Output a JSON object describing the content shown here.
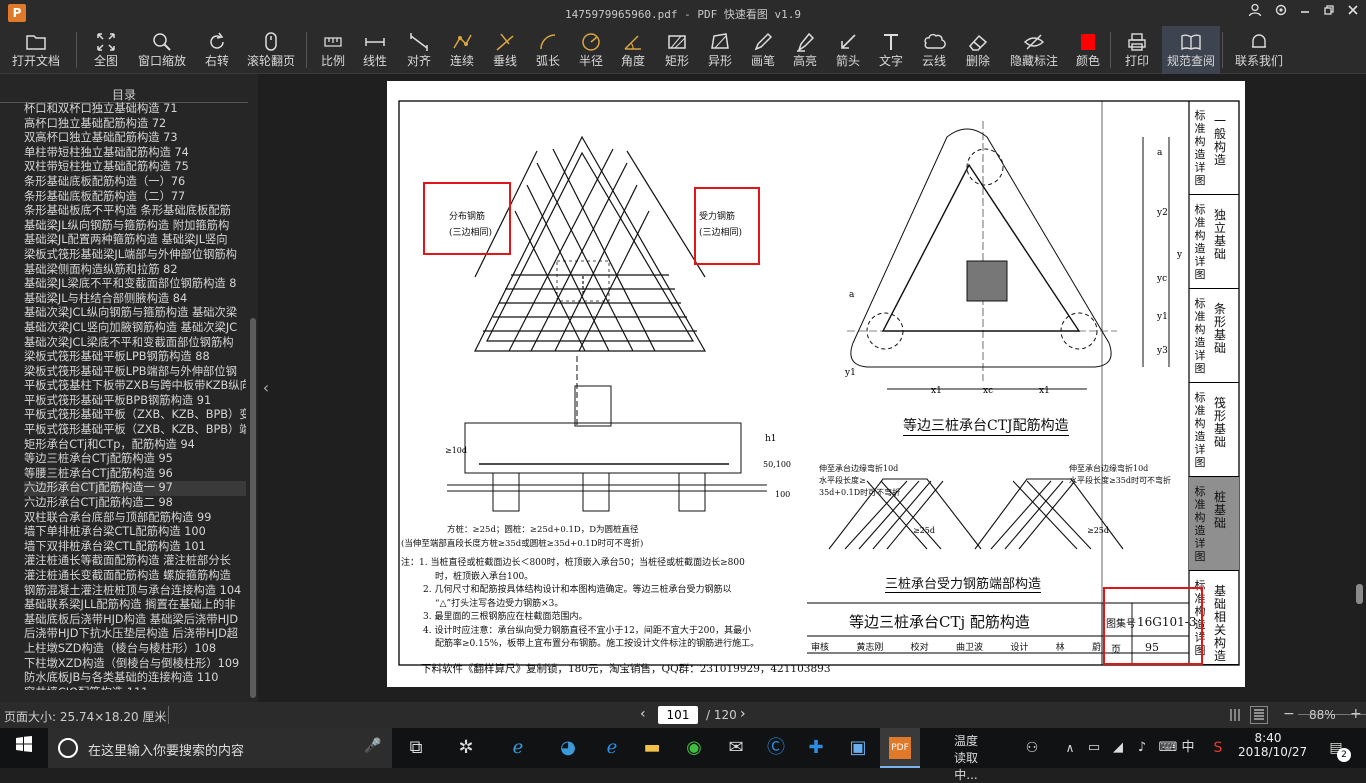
{
  "window": {
    "title": "1475979965960.pdf - PDF 快速看图 v1.9",
    "logo": "P",
    "controls": [
      "user-icon",
      "settings-icon",
      "minimize-icon",
      "maximize-icon",
      "close-icon"
    ]
  },
  "toolbar": [
    {
      "label": "打开文档",
      "icon": "folder-icon"
    },
    {
      "label": "全图",
      "icon": "fit-page-icon"
    },
    {
      "label": "窗口缩放",
      "icon": "zoom-icon"
    },
    {
      "label": "右转",
      "icon": "rotate-right-icon"
    },
    {
      "label": "滚轮翻页",
      "icon": "mouse-wheel-icon"
    },
    {
      "label": "比例",
      "icon": "scale-icon"
    },
    {
      "label": "线性",
      "icon": "linear-measure-icon"
    },
    {
      "label": "对齐",
      "icon": "align-measure-icon"
    },
    {
      "label": "连续",
      "icon": "continuous-measure-icon"
    },
    {
      "label": "垂线",
      "icon": "perpendicular-icon"
    },
    {
      "label": "弧长",
      "icon": "arc-length-icon"
    },
    {
      "label": "半径",
      "icon": "radius-icon"
    },
    {
      "label": "角度",
      "icon": "angle-icon"
    },
    {
      "label": "矩形",
      "icon": "rectangle-area-icon"
    },
    {
      "label": "异形",
      "icon": "polygon-area-icon"
    },
    {
      "label": "画笔",
      "icon": "pen-icon"
    },
    {
      "label": "高亮",
      "icon": "highlighter-icon"
    },
    {
      "label": "箭头",
      "icon": "arrow-icon"
    },
    {
      "label": "文字",
      "icon": "text-icon"
    },
    {
      "label": "云线",
      "icon": "cloud-line-icon"
    },
    {
      "label": "删除",
      "icon": "eraser-icon"
    },
    {
      "label": "隐藏标注",
      "icon": "hide-annotation-icon"
    },
    {
      "label": "颜色",
      "icon": "color-swatch-icon"
    },
    {
      "label": "打印",
      "icon": "printer-icon"
    },
    {
      "label": "规范查阅",
      "icon": "book-icon"
    },
    {
      "label": "联系我们",
      "icon": "contact-icon"
    }
  ],
  "colors": {
    "annotation_color": "#ff0000",
    "highlight_box": "#e0161b"
  },
  "sidebar": {
    "title": "目录",
    "selected_index": 26,
    "items": [
      "杯口和双杯口独立基础构造 71",
      "高杯口独立基础配筋构造 72",
      "双高杯口独立基础配筋构造 73",
      "单柱带短柱独立基础配筋构造 74",
      "双柱带短柱独立基础配筋构造 75",
      "条形基础底板配筋构造（一）76",
      "条形基础底板配筋构造（二）77",
      "条形基础板底不平构造 条形基础底板配筋",
      "基础梁JL纵向钢筋与箍筋构造 附加箍筋构",
      "基础梁JL配置两种箍筋构造 基础梁JL竖向",
      "梁板式筏形基础梁JL端部与外伸部位钢筋构",
      "基础梁侧面构造纵筋和拉筋 82",
      "基础梁JL梁底不平和变截面部位钢筋构造 8",
      "基础梁JL与柱结合部侧腋构造 84",
      "基础次梁JCL纵向钢筋与箍筋构造 基础次梁",
      "基础次梁JCL竖向加腋钢筋构造 基础次梁JC",
      "基础次梁JCL梁底不平和变截面部位钢筋构",
      "梁板式筏形基础平板LPB钢筋构造 88",
      "梁板式筏形基础平板LPB端部与外伸部位钢",
      "平板式筏基柱下板带ZXB与跨中板带KZB纵向",
      "平板式筏形基础平板BPB钢筋构造 91",
      "平板式筏形基础平板（ZXB、KZB、BPB）变截",
      "平板式筏形基础平板（ZXB、KZB、BPB）端部",
      "矩形承台CTj和CTp，配筋构造 94",
      "等边三桩承台CTj配筋构造 95",
      "等腰三桩承台CTj配筋构造 96",
      "六边形承台CTj配筋构造一 97",
      "六边形承台CTj配筋构造二 98",
      "双柱联合承台底部与顶部配筋构造 99",
      "墙下单排桩承台梁CTL配筋构造 100",
      "墙下双排桩承台梁CTL配筋构造 101",
      "灌注桩通长等截面配筋构造 灌注桩部分长",
      "灌注桩通长变截面配筋构造 螺旋箍筋构造",
      "钢筋混凝土灌注桩桩顶与承台连接构造 104",
      "基础联系梁JLL配筋构造 搁置在基础上的非",
      "基础底板后浇带HJD构造 基础梁后浇带HJD",
      "后浇带HJD下抗水压垫层构造 后浇带HJD超",
      "上柱墩SZD构造（棱台与棱柱形）108",
      "下柱墩XZD构造（倒棱台与倒棱柱形）109",
      "防水底板JB与各类基础的连接构造 110",
      "窗井墙CJQ配筋构造 111",
      "封底"
    ]
  },
  "document": {
    "label_distribution": "分布钢筋",
    "label_distribution_sub": "(三边相同)",
    "label_stressed": "受力钢筋",
    "label_stressed_sub": "(三边相同)",
    "title_plan": "等边三桩承台CTJ配筋构造",
    "title_end": "三桩承台受力钢筋端部构造",
    "dim_note": "方桩：≥25d；圆桩：≥25d+0.1D，D为圆桩直径",
    "dim_note2": "(当伸至端部直段长度方桩≥35d或圆桩≥35d+0.1D时可不弯折)",
    "end_note_left": "伸至承台边缘弯折10d",
    "end_note_left2": "水平段长度≥",
    "end_note_left3": "35d+0.1D时可不弯折",
    "end_note_right": "伸至承台边缘弯折10d",
    "end_note_right2": "水平段长度≥35d时可不弯折",
    "notes": [
      "注：1. 当桩直径或桩截面边长＜800时，桩顶嵌入承台50；当桩径或桩截面边长≥800",
      "时，桩顶嵌入承台100。",
      "2. 几何尺寸和配筋按具体结构设计和本图构造确定。等边三桩承台受力钢筋以",
      "“△”打头注写各边受力钢筋×3。",
      "3. 最里面的三根钢筋应在柱截面范围内。",
      "4. 设计时应注意：承台纵向受力钢筋直径不宜小于12，间距不宜大于200，其最小",
      "配筋率≥0.15%，板带上宜布置分布钢筋。施工按设计文件标注的钢筋进行施工。"
    ],
    "titleblock_title": "等边三桩承台CTj 配筋构造",
    "atlas_label": "图集号",
    "atlas_no": "16G101-3",
    "page_label": "页",
    "page_no": "95",
    "sign_row": [
      "审核",
      "黄志刚",
      "",
      "校对",
      "曲卫波",
      "",
      "设计",
      "林",
      "蔚",
      ""
    ],
    "watermark": "下料软件《翻样算尺》复制锁，180元，淘宝销售，QQ群：231019929，421103893",
    "side_tabs": [
      "标准构造详图 一般构造",
      "标准构造详图 独立基础",
      "标准构造详图 条形基础",
      "标准构造详图 筏形基础",
      "标准构造详图 桩基础",
      "标准构造详图 基础相关构造"
    ],
    "dims": [
      "a",
      "y2",
      "y",
      "yc",
      "y1",
      "y3",
      "x1",
      "xc",
      "x1",
      "a",
      "y1",
      "h1",
      "50,100",
      "≥10d",
      "100",
      "≥25d",
      "≥25d"
    ]
  },
  "status": {
    "page_size": "页面大小: 25.74×18.20 厘米",
    "current_page": "101",
    "total_pages": "/ 120",
    "zoom": "88%",
    "zoom_minus": "−",
    "zoom_plus": "+"
  },
  "taskbar": {
    "search_placeholder": "在这里输入你要搜索的内容",
    "weather_title": "温度",
    "weather_sub": "读取中...",
    "ime": "中",
    "time": "8:40",
    "date": "2018/10/27",
    "notifications": "2"
  }
}
